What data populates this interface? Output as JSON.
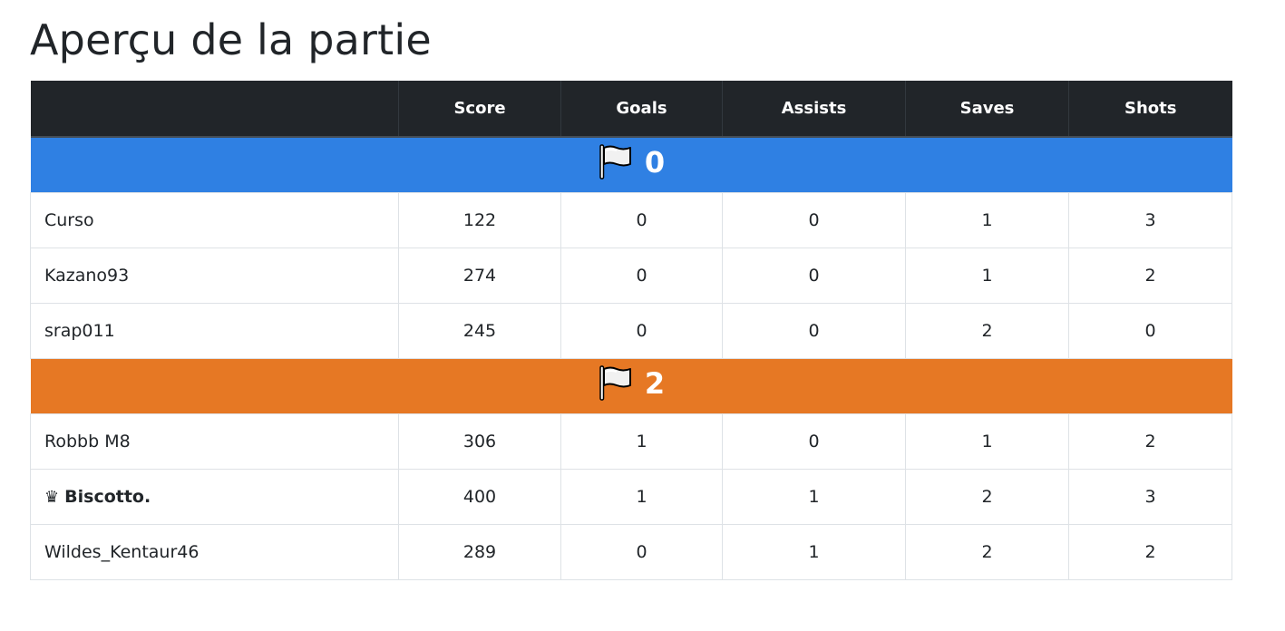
{
  "page": {
    "title": "Aperçu de la partie"
  },
  "table": {
    "headers": [
      "",
      "Score",
      "Goals",
      "Assists",
      "Saves",
      "Shots"
    ],
    "teams": [
      {
        "color": "#2f80e3",
        "icon": "flag-icon",
        "score": "0",
        "players": [
          {
            "name": "Curso",
            "mvp": false,
            "score": "122",
            "goals": "0",
            "assists": "0",
            "saves": "1",
            "shots": "3"
          },
          {
            "name": "Kazano93",
            "mvp": false,
            "score": "274",
            "goals": "0",
            "assists": "0",
            "saves": "1",
            "shots": "2"
          },
          {
            "name": "srap011",
            "mvp": false,
            "score": "245",
            "goals": "0",
            "assists": "0",
            "saves": "2",
            "shots": "0"
          }
        ]
      },
      {
        "color": "#e67824",
        "icon": "flag-icon",
        "score": "2",
        "players": [
          {
            "name": "Robbb M8",
            "mvp": false,
            "score": "306",
            "goals": "1",
            "assists": "0",
            "saves": "1",
            "shots": "2"
          },
          {
            "name": "Biscotto.",
            "mvp": true,
            "mvp_icon": "crown-icon",
            "score": "400",
            "goals": "1",
            "assists": "1",
            "saves": "2",
            "shots": "3"
          },
          {
            "name": "Wildes_Kentaur46",
            "mvp": false,
            "score": "289",
            "goals": "0",
            "assists": "1",
            "saves": "2",
            "shots": "2"
          }
        ]
      }
    ]
  },
  "colors": {
    "header_bg": "#212529",
    "blue_team": "#2f80e3",
    "orange_team": "#e67824"
  }
}
